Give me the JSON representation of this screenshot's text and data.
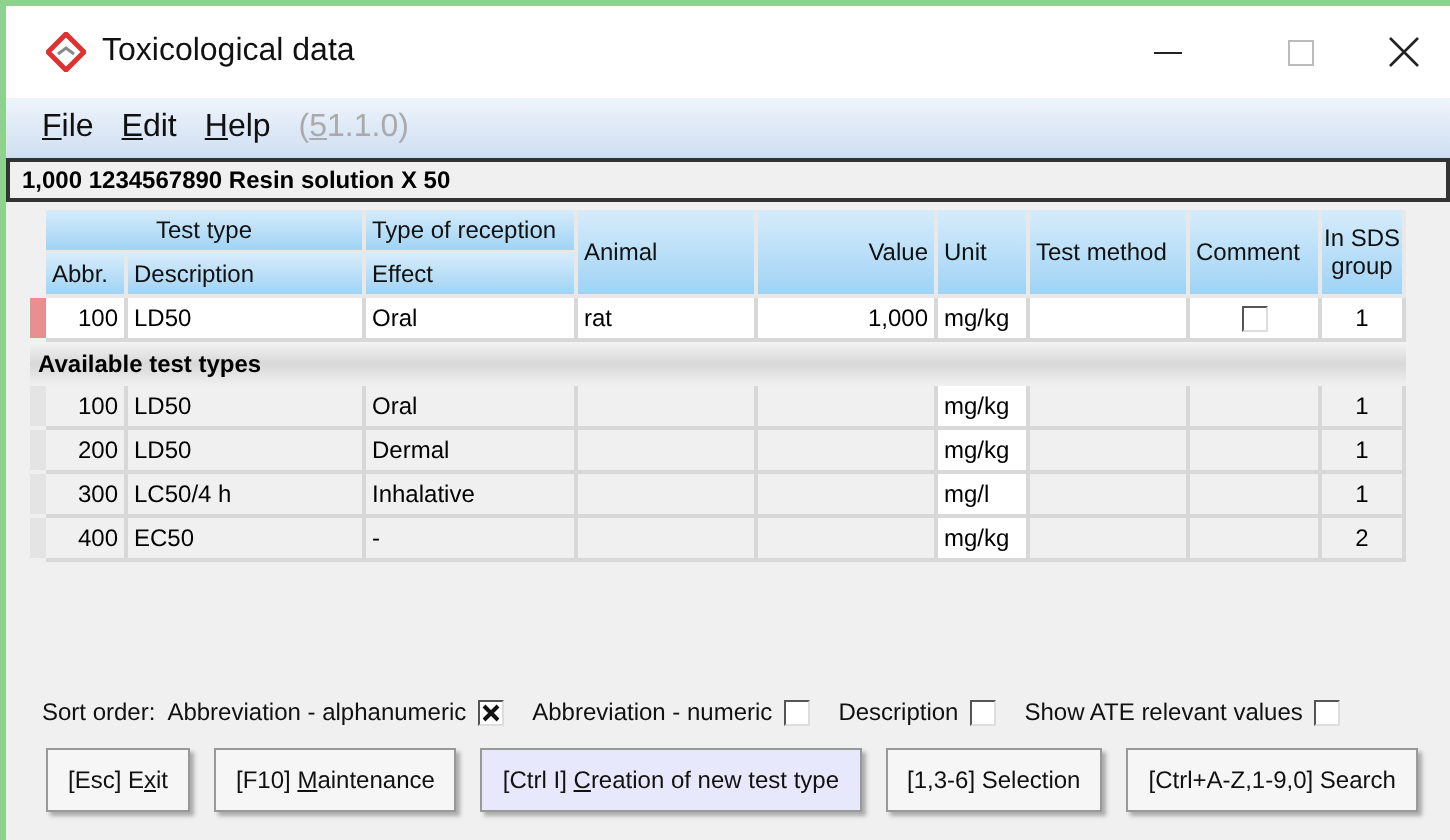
{
  "window": {
    "title": "Toxicological data"
  },
  "menu": [
    {
      "key": "F",
      "rest": "ile",
      "disabled": false
    },
    {
      "key": "E",
      "rest": "dit",
      "disabled": false
    },
    {
      "key": "H",
      "rest": "elp",
      "disabled": false
    },
    {
      "prefix": "(",
      "key": "5",
      "rest": "1.1.0)",
      "disabled": true
    }
  ],
  "record": "1,000 1234567890 Resin solution X 50",
  "table": {
    "group_header": "Test type",
    "columns": [
      "Abbr.",
      "Description",
      "Type of reception",
      "Effect",
      "Animal",
      "Value",
      "Unit",
      "Test method",
      "Comment",
      "In SDS group"
    ],
    "rows": [
      {
        "selected": true,
        "editable": true,
        "abbr": "100",
        "description": "LD50",
        "effect": "Oral",
        "animal": "rat",
        "value": "1,000",
        "unit": "mg/kg",
        "comment_checked": false,
        "sds_group": "1"
      }
    ],
    "section": "Available test types",
    "available": [
      {
        "selected": false,
        "editable": false,
        "abbr": "100",
        "description": "LD50",
        "effect": "Oral",
        "unit": "mg/kg",
        "sds_group": "1"
      },
      {
        "selected": false,
        "editable": false,
        "abbr": "200",
        "description": "LD50",
        "effect": "Dermal",
        "unit": "mg/kg",
        "sds_group": "1"
      },
      {
        "selected": false,
        "editable": false,
        "abbr": "300",
        "description": "LC50/4 h",
        "effect": "Inhalative",
        "unit": "mg/l",
        "sds_group": "1"
      },
      {
        "selected": false,
        "editable": false,
        "abbr": "400",
        "description": "EC50",
        "effect": "-",
        "unit": "mg/kg",
        "sds_group": "2"
      }
    ]
  },
  "sort_order": {
    "label": "Sort order:",
    "options": [
      {
        "label": "Abbreviation - alphanumeric",
        "checked": true
      },
      {
        "label": "Abbreviation - numeric",
        "checked": false
      },
      {
        "label": "Description",
        "checked": false
      },
      {
        "label": "Show ATE relevant values",
        "checked": false
      }
    ]
  },
  "buttons": [
    {
      "prefix": "[Esc] E",
      "key": "x",
      "rest": "it",
      "highlighted": false
    },
    {
      "prefix": "[F10] ",
      "key": "M",
      "rest": "aintenance",
      "highlighted": false
    },
    {
      "prefix": "[Ctrl I] ",
      "key": "C",
      "rest": "reation of new test type",
      "highlighted": true
    },
    {
      "prefix": "[1,3-6] Selection",
      "highlighted": false
    },
    {
      "prefix": "[Ctrl+A-Z,1-9,0] Search",
      "highlighted": false
    }
  ]
}
